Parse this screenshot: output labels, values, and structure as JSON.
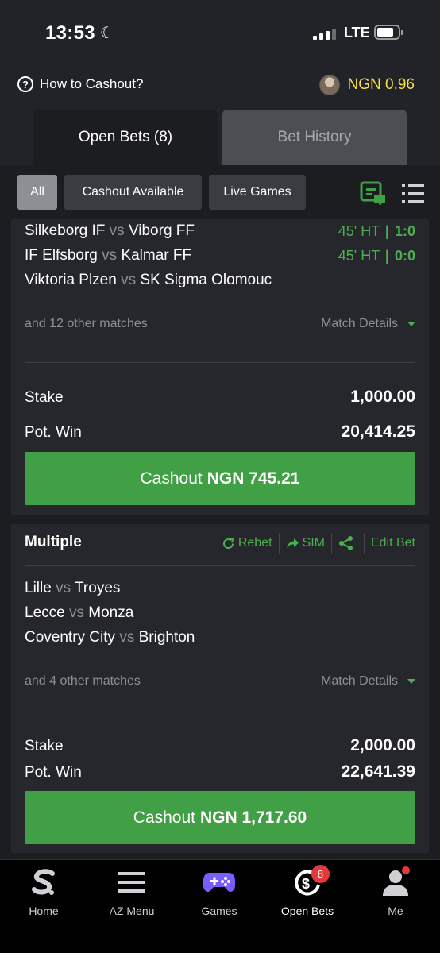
{
  "status_bar": {
    "time": "13:53",
    "network": "LTE",
    "moon_icon": "moon-icon",
    "battery_level": 0.7
  },
  "header": {
    "help_label": "How to Cashout?",
    "balance": "NGN 0.96",
    "balance_color": "#f6e04a"
  },
  "tabs": {
    "open": "Open Bets (8)",
    "history": "Bet History"
  },
  "filters": {
    "all": "All",
    "cashout_available": "Cashout Available",
    "live_games": "Live Games"
  },
  "cards": [
    {
      "matches": [
        {
          "home": "Silkeborg IF",
          "vs": "vs",
          "away": "Viborg FF",
          "time": "45' HT",
          "sep": "|",
          "score": "1:0"
        },
        {
          "home": "IF Elfsborg",
          "vs": "vs",
          "away": "Kalmar FF",
          "time": "45' HT",
          "sep": "|",
          "score": "0:0"
        },
        {
          "home": "Viktoria Plzen",
          "vs": "vs",
          "away": "SK Sigma Olomouc"
        }
      ],
      "others": "and 12 other matches",
      "details": "Match Details",
      "stake_label": "Stake",
      "stake": "1,000.00",
      "potwin_label": "Pot. Win",
      "potwin": "20,414.25",
      "cashout_prefix": "Cashout",
      "cashout_amount": "NGN 745.21"
    },
    {
      "title": "Multiple",
      "actions": {
        "rebet": "Rebet",
        "sim": "SIM",
        "edit": "Edit Bet"
      },
      "matches": [
        {
          "home": "Lille",
          "vs": "vs",
          "away": "Troyes"
        },
        {
          "home": "Lecce",
          "vs": "vs",
          "away": "Monza"
        },
        {
          "home": "Coventry City",
          "vs": "vs",
          "away": "Brighton"
        }
      ],
      "others": "and 4 other matches",
      "details": "Match Details",
      "stake_label": "Stake",
      "stake": "2,000.00",
      "potwin_label": "Pot. Win",
      "potwin": "22,641.39",
      "cashout_prefix": "Cashout",
      "cashout_amount": "NGN 1,717.60"
    }
  ],
  "nav": {
    "home": "Home",
    "az_menu": "AZ Menu",
    "games": "Games",
    "open_bets": "Open Bets",
    "open_bets_badge": "8",
    "me": "Me"
  },
  "colors": {
    "accent_green": "#41a045",
    "text_green": "#4caf50",
    "badge_red": "#e3393b"
  }
}
